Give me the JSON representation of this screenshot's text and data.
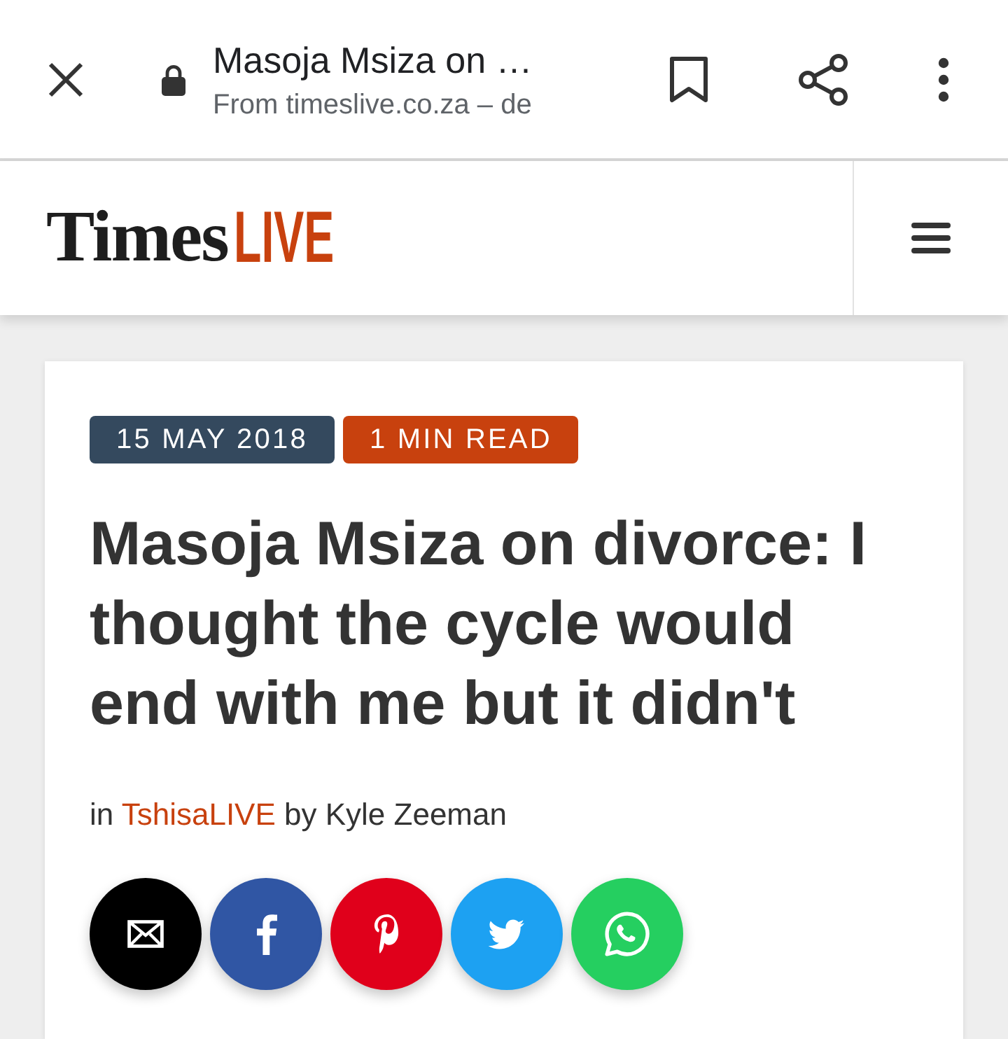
{
  "browser_bar": {
    "title": "Masoja Msiza on …",
    "url": "From timeslive.co.za – de"
  },
  "site_header": {
    "logo": {
      "word_1": "Times",
      "word_2": "LIVE"
    }
  },
  "article": {
    "tags": [
      {
        "text": "15 MAY 2018",
        "color": "#34495e"
      },
      {
        "text": "1 MIN READ",
        "color": "#c8410e"
      }
    ],
    "headline": "Masoja Msiza on divorce: I thought the cycle would end with me but it didn't",
    "byline": {
      "before": "in",
      "section": "TshisaLIVE",
      "after": "by Kyle Zeeman"
    },
    "share_buttons": [
      {
        "kind": "email",
        "color": "#000000"
      },
      {
        "kind": "facebook",
        "color": "#3056a4"
      },
      {
        "kind": "pinterest",
        "color": "#e0001b"
      },
      {
        "kind": "twitter",
        "color": "#1da1f2"
      },
      {
        "kind": "whatsapp",
        "color": "#25cf60"
      }
    ]
  }
}
